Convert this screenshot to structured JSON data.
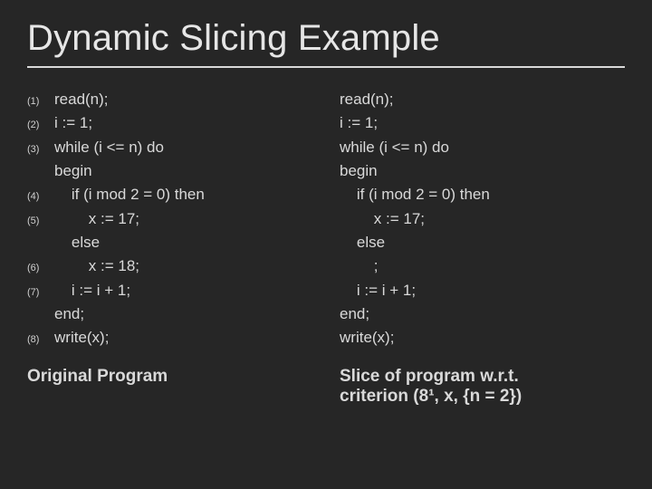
{
  "title": "Dynamic Slicing Example",
  "left": {
    "lines": [
      {
        "n": "(1)",
        "t": "read(n);"
      },
      {
        "n": "(2)",
        "t": "i := 1;"
      },
      {
        "n": "(3)",
        "t": "while (i <= n) do"
      },
      {
        "n": "",
        "t": "begin"
      },
      {
        "n": "(4)",
        "t": "    if (i mod 2 = 0) then"
      },
      {
        "n": "(5)",
        "t": "        x := 17;"
      },
      {
        "n": "",
        "t": "    else"
      },
      {
        "n": "(6)",
        "t": "        x := 18;"
      },
      {
        "n": "(7)",
        "t": "    i := i + 1;"
      },
      {
        "n": "",
        "t": "end;"
      },
      {
        "n": "(8)",
        "t": "write(x);"
      }
    ],
    "caption": "Original Program"
  },
  "right": {
    "lines": [
      {
        "t": "read(n);"
      },
      {
        "t": "i := 1;"
      },
      {
        "t": "while (i <= n) do"
      },
      {
        "t": "begin"
      },
      {
        "t": "    if (i mod 2 = 0) then"
      },
      {
        "t": "        x := 17;"
      },
      {
        "t": "    else"
      },
      {
        "t": "        ;"
      },
      {
        "t": "    i := i + 1;"
      },
      {
        "t": "end;"
      },
      {
        "t": "write(x);"
      }
    ],
    "caption1": "Slice of program w.r.t.",
    "caption2": "criterion (8¹, x, {n = 2})"
  }
}
